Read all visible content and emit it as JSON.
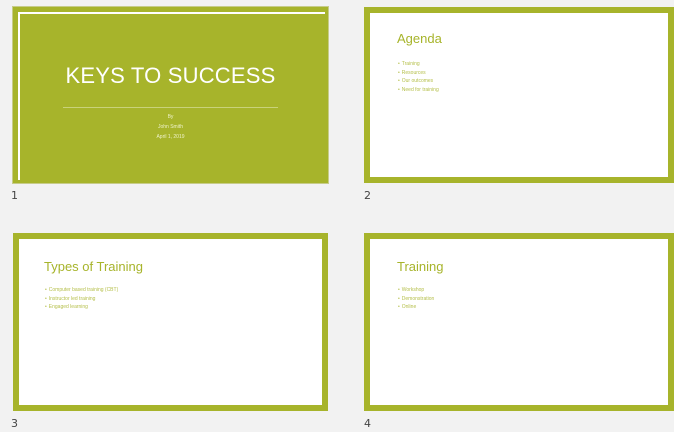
{
  "colors": {
    "accent": "#a7b42b",
    "background": "#f2f2f2"
  },
  "slides": [
    {
      "number": "1",
      "title": "KEYS TO SUCCESS",
      "byline": "By",
      "author": "John Smith",
      "date": "April 1, 2019"
    },
    {
      "number": "2",
      "title": "Agenda",
      "bullets": [
        "Training",
        "Resources",
        "Our outcomes",
        "Need for training"
      ]
    },
    {
      "number": "3",
      "title": "Types of Training",
      "bullets": [
        "Computer based training (CBT)",
        "Instructor led training",
        "Engaged learning"
      ]
    },
    {
      "number": "4",
      "title": "Training",
      "bullets": [
        "Workshop",
        "Demonstration",
        "Online"
      ]
    }
  ]
}
